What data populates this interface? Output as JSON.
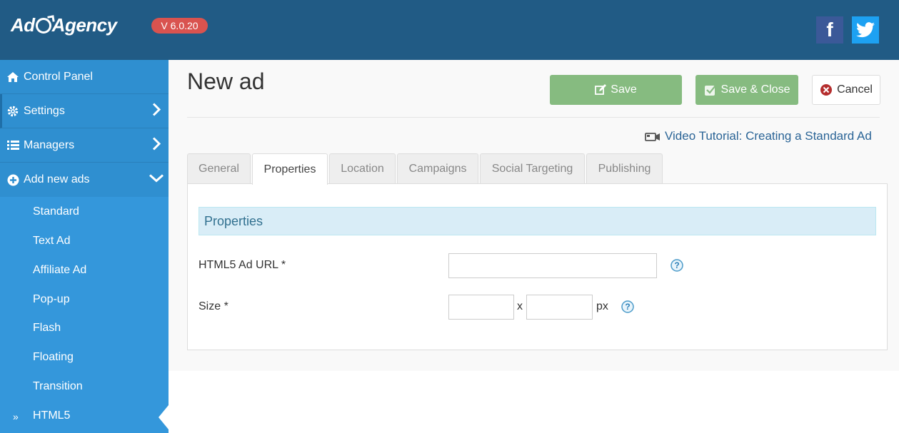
{
  "header": {
    "logo_text_a": "Ad",
    "logo_text_b": "Agency",
    "version": "V 6.0.20",
    "social": [
      "facebook-icon",
      "twitter-icon"
    ],
    "colors": {
      "bar": "#215b85",
      "version_badge": "#d9534f",
      "facebook": "#3b5998",
      "twitter": "#1da1f2"
    }
  },
  "sidebar": {
    "items": [
      {
        "label": "Control Panel",
        "icon": "home-icon"
      },
      {
        "label": "Settings",
        "icon": "gear-icon"
      },
      {
        "label": "Managers",
        "icon": "list-icon"
      },
      {
        "label": "Add new ads",
        "icon": "plus-circle-icon"
      }
    ],
    "sub_items": [
      "Standard",
      "Text Ad",
      "Affiliate Ad",
      "Pop-up",
      "Flash",
      "Floating",
      "Transition",
      "HTML5"
    ],
    "active_marker": "»",
    "colors": {
      "background": "#3497db",
      "item": "#2f8fd0"
    }
  },
  "main": {
    "title": "New ad",
    "buttons": {
      "save": "Save",
      "save_close": "Save & Close",
      "cancel": "Cancel"
    },
    "tutorial": "Video Tutorial: Creating a Standard Ad",
    "tabs": [
      "General",
      "Properties",
      "Location",
      "Campaigns",
      "Social Targeting",
      "Publishing"
    ],
    "active_tab": "Properties",
    "section_title": "Properties",
    "fields": {
      "url_label": "HTML5 Ad URL *",
      "url_value": "",
      "size_label": "Size *",
      "width_value": "",
      "height_value": "",
      "size_separator": "x",
      "size_unit": "px"
    },
    "colors": {
      "save_button": "#86bb80",
      "section_head": "#d9edf7",
      "link": "#2a6496"
    }
  }
}
